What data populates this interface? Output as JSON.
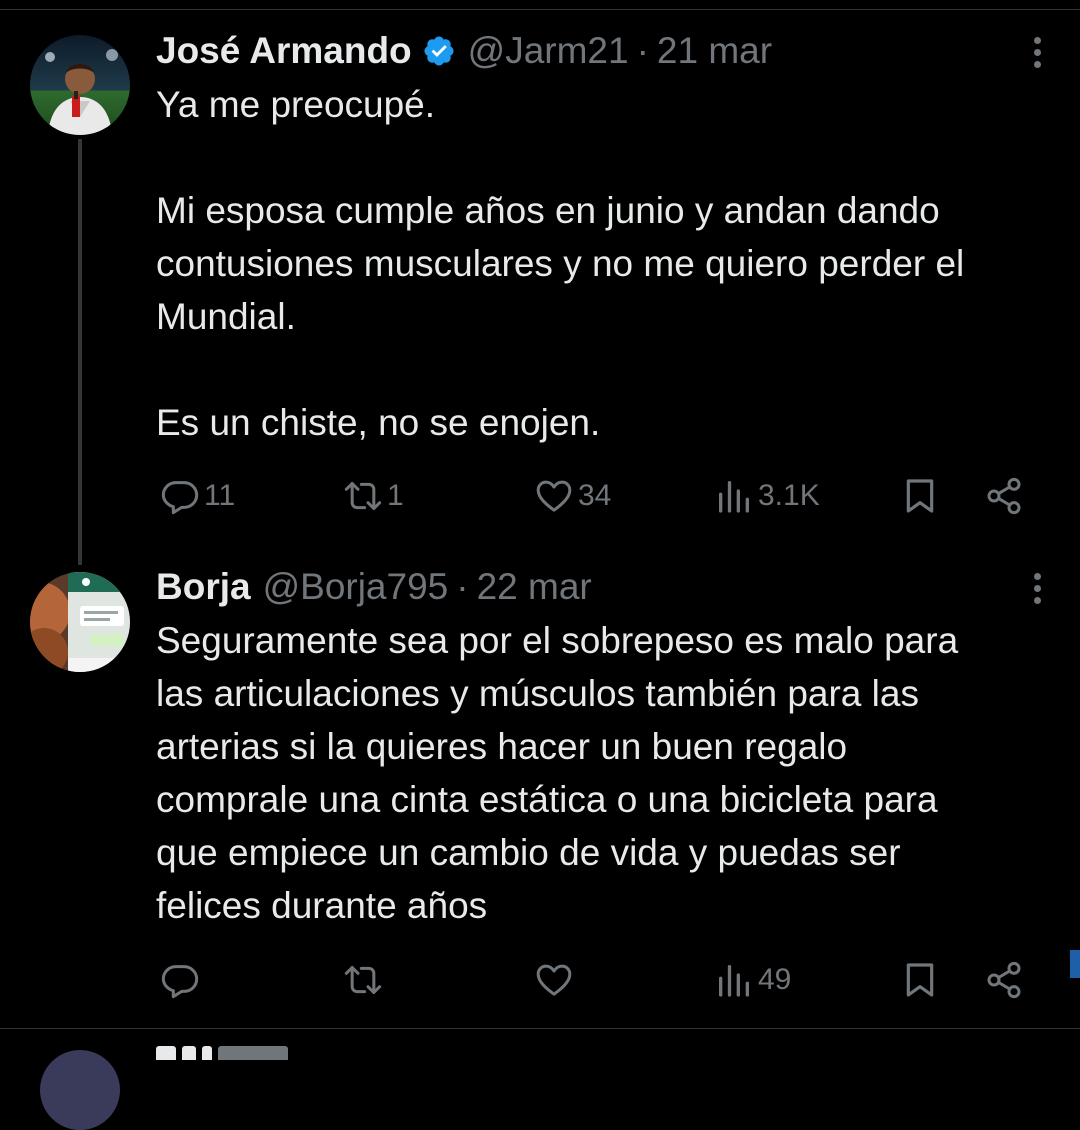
{
  "tweets": [
    {
      "name": "José Armando",
      "verified": true,
      "handle": "@Jarm21",
      "separator": "·",
      "date": "21 mar",
      "paragraphs": [
        "Ya me preocupé.",
        "Mi esposa cumple años en junio y andan dando\ncontusiones musculares y no me quiero perder el\nMundial.",
        "Es un chiste, no se enojen."
      ],
      "counts": {
        "replies": "11",
        "retweets": "1",
        "likes": "34",
        "views": "3.1K"
      }
    },
    {
      "name": "Borja",
      "verified": false,
      "handle": "@Borja795",
      "separator": "·",
      "date": "22 mar",
      "paragraphs": [
        "Seguramente sea por el sobrepeso es malo para\nlas articulaciones y músculos también para las\narterias si la quieres hacer un buen regalo\ncomprale una cinta estática o una bicicleta para\nque empiece un cambio de vida y puedas ser\nfelices durante años"
      ],
      "counts": {
        "replies": "",
        "retweets": "",
        "likes": "",
        "views": "49"
      }
    }
  ],
  "icons": {
    "reply": "reply-icon",
    "retweet": "retweet-icon",
    "like": "heart-icon",
    "views": "views-icon",
    "bookmark": "bookmark-icon",
    "share": "share-icon",
    "more": "more-icon",
    "verified": "verified-badge-icon"
  },
  "colors": {
    "background": "#000000",
    "text": "#e7e9ea",
    "secondary": "#71767b",
    "verified": "#1d9bf0"
  }
}
